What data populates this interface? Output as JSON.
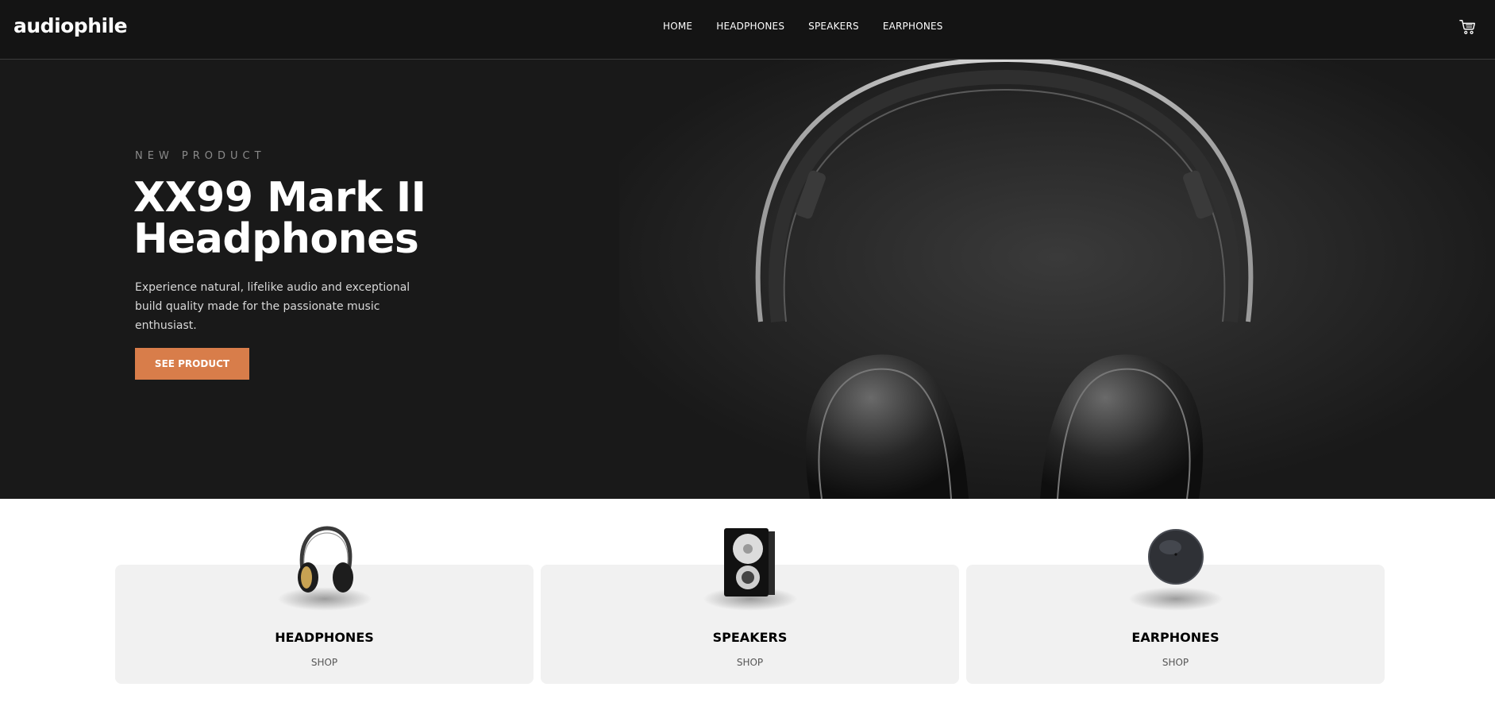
{
  "header": {
    "logo": "audiophile",
    "nav": [
      "HOME",
      "HEADPHONES",
      "SPEAKERS",
      "EARPHONES"
    ],
    "cart_icon": "cart-icon"
  },
  "hero": {
    "eyebrow": "NEW PRODUCT",
    "title_line1": "XX99 Mark II",
    "title_line2": "Headphones",
    "description": "Experience natural, lifelike audio and exceptional build quality made for the passionate music enthusiast.",
    "cta_label": "SEE PRODUCT"
  },
  "categories": [
    {
      "name": "HEADPHONES",
      "shop": "SHOP"
    },
    {
      "name": "SPEAKERS",
      "shop": "SHOP"
    },
    {
      "name": "EARPHONES",
      "shop": "SHOP"
    }
  ],
  "colors": {
    "accent": "#d87d4a",
    "header_bg": "#141414",
    "hero_bg": "#191919",
    "card_bg": "#f1f1f1"
  }
}
